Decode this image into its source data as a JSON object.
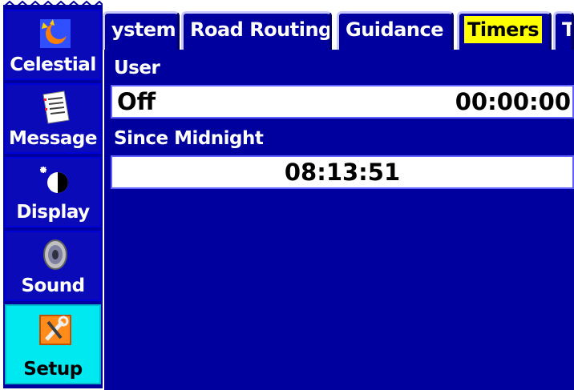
{
  "sidebar": {
    "items": [
      {
        "label": "Celestial",
        "icon": "celestial-icon",
        "active": false
      },
      {
        "label": "Message",
        "icon": "message-icon",
        "active": false
      },
      {
        "label": "Display",
        "icon": "display-icon",
        "active": false
      },
      {
        "label": "Sound",
        "icon": "sound-icon",
        "active": false
      },
      {
        "label": "Setup",
        "icon": "setup-icon",
        "active": true
      }
    ]
  },
  "tabs": [
    {
      "label": "ystem",
      "active": false
    },
    {
      "label": "Road Routing",
      "active": false
    },
    {
      "label": "Guidance",
      "active": false
    },
    {
      "label": "Timers",
      "active": true
    },
    {
      "label": "T",
      "active": false
    }
  ],
  "timers": {
    "user_label": "User",
    "user_mode": "Off",
    "user_time": "00:00:00",
    "midnight_label": "Since Midnight",
    "midnight_time": "08:13:51"
  },
  "colors": {
    "background": "#00009e",
    "active_sidebar": "#00e8f0",
    "active_tab_highlight": "#ffff00",
    "field": "#ffffff"
  }
}
